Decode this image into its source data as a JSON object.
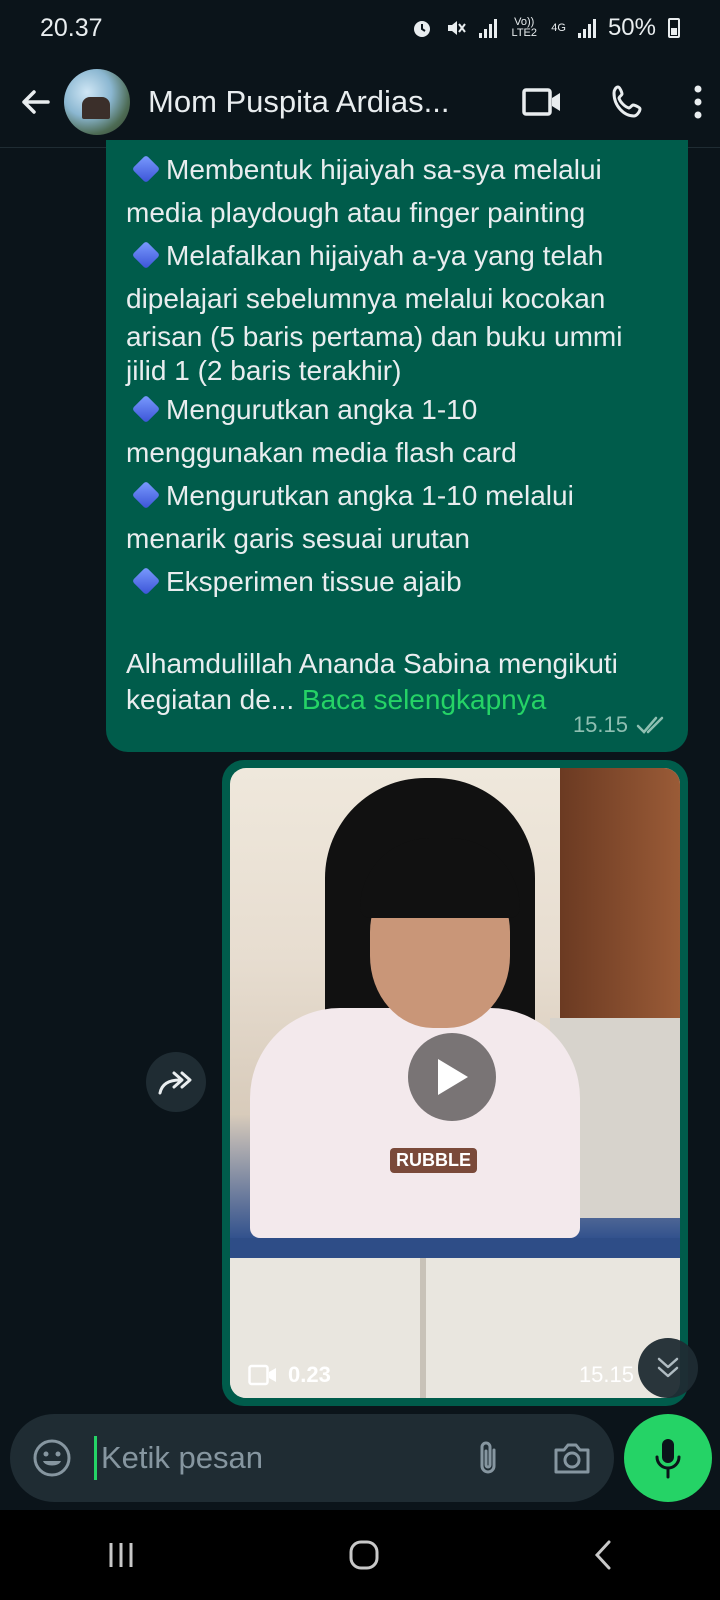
{
  "status_bar": {
    "time": "20.37",
    "battery": "50%",
    "network_tag_1": "Vo)) LTE2",
    "network_tag_2": "4G"
  },
  "header": {
    "contact_name": "Mom Puspita Ardias..."
  },
  "message_1": {
    "lines": [
      "Membentuk hijaiyah sa-sya melalui",
      "media playdough atau finger painting",
      "Melafalkan hijaiyah a-ya yang telah",
      "dipelajari sebelumnya melalui kocokan",
      "arisan (5 baris pertama) dan buku ummi",
      "jilid 1 (2 baris terakhir)",
      "Mengurutkan angka 1-10",
      "menggunakan media flash card",
      "Mengurutkan angka 1-10 melalui",
      "menarik garis sesuai urutan",
      "Eksperimen tissue ajaib",
      "Alhamdulillah Ananda Sabina mengikuti",
      "kegiatan de..."
    ],
    "read_more": "Baca selengkapnya",
    "time": "15.15"
  },
  "message_2": {
    "video_duration": "0.23",
    "time": "15.15",
    "shirt_text": "RUBBLE"
  },
  "composer": {
    "placeholder": "Ketik pesan"
  },
  "colors": {
    "accent": "#25d366",
    "bubble_out": "#005c4b",
    "background": "#0b141a"
  }
}
